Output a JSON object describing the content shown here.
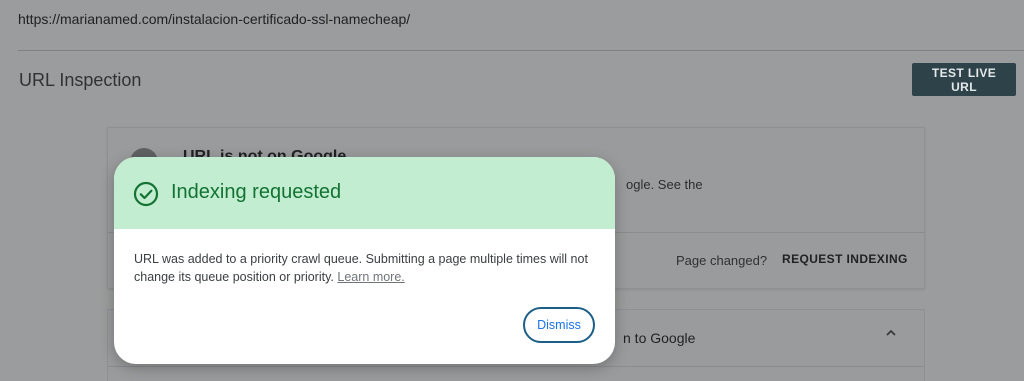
{
  "address_bar": {
    "url": "https://marianamed.com/instalacion-certificado-ssl-namecheap/"
  },
  "header": {
    "title": "URL Inspection",
    "test_live_url": "TEST LIVE URL"
  },
  "status_card": {
    "title": "URL is not on Google",
    "description_visible": "ogle. See the",
    "page_changed": "Page changed?",
    "request_indexing": "REQUEST INDEXING"
  },
  "coverage_card": {
    "title_visible": "n to Google"
  },
  "dialog": {
    "title": "Indexing requested",
    "body": "URL was added to a priority crawl queue. Submitting a page multiple times will not change its queue position or priority.",
    "learn_more": "Learn more.",
    "dismiss": "Dismiss"
  },
  "colors": {
    "dialog_header_bg": "#c3edd0",
    "success_green": "#137333",
    "button_dark": "#2e4349",
    "dismiss_border": "#1b5e87",
    "link_blue": "#1a73e8"
  },
  "icons": {
    "dialog_icon": "check-circle-icon",
    "status_icon": "status-circle-icon",
    "expand_icon": "chevron-up-icon"
  }
}
